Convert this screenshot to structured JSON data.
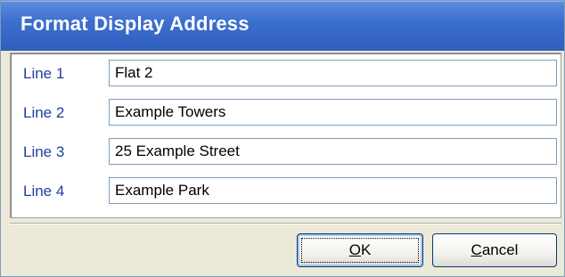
{
  "window": {
    "title": "Format Display Address"
  },
  "fields": [
    {
      "label": "Line 1",
      "value": "Flat 2"
    },
    {
      "label": "Line 2",
      "value": "Example Towers"
    },
    {
      "label": "Line 3",
      "value": "25 Example Street"
    },
    {
      "label": "Line 4",
      "value": "Example Park"
    }
  ],
  "buttons": {
    "ok": {
      "mnemonic": "O",
      "rest": "K"
    },
    "cancel": {
      "mnemonic": "C",
      "rest": "ancel"
    }
  },
  "colors": {
    "titlebar": "#3d6fcf",
    "label_text": "#1d3ea0",
    "dialog_background": "#ece9d8"
  }
}
